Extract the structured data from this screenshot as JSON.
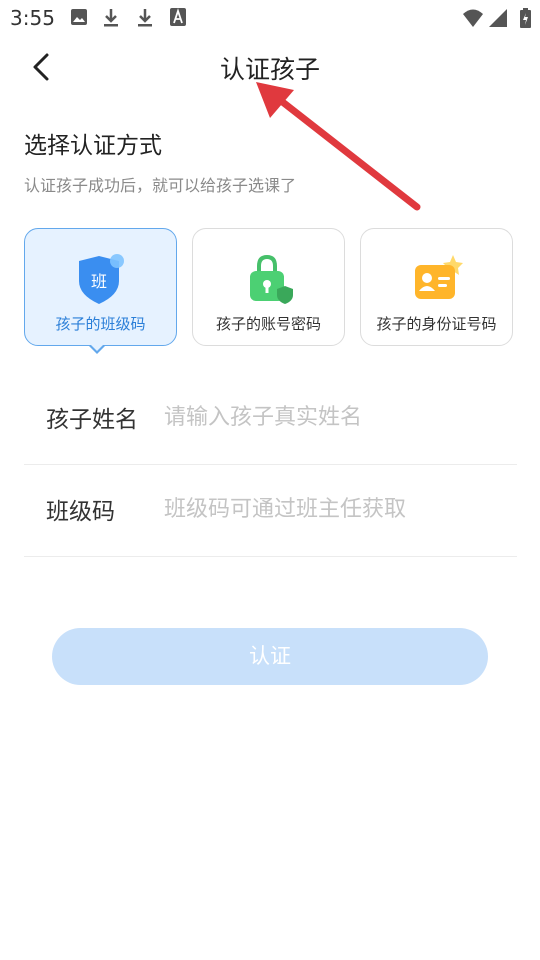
{
  "status_bar": {
    "time": "3:55",
    "icons": [
      "image-icon",
      "download-icon",
      "download-icon",
      "a-letter-icon",
      "wifi-icon",
      "signal-icon",
      "battery-icon"
    ]
  },
  "nav": {
    "back_icon": "back-chevron-icon",
    "title": "认证孩子"
  },
  "annotation": {
    "arrow_color": "#e0393e"
  },
  "section": {
    "title": "选择认证方式",
    "subtitle": "认证孩子成功后，就可以给孩子选课了"
  },
  "methods": [
    {
      "label": "孩子的班级码",
      "icon": "class-shield-icon",
      "icon_text": "班",
      "selected": true
    },
    {
      "label": "孩子的账号密码",
      "icon": "lock-icon",
      "selected": false
    },
    {
      "label": "孩子的身份证号码",
      "icon": "id-card-icon",
      "selected": false
    }
  ],
  "form": {
    "name_label": "孩子姓名",
    "name_placeholder": "请输入孩子真实姓名",
    "code_label": "班级码",
    "code_placeholder": "班级码可通过班主任获取"
  },
  "submit": {
    "label": "认证",
    "color": "#c8e0fa"
  },
  "colors": {
    "accent": "#2b7fd8",
    "selected_bg": "#e6f2ff",
    "selected_border": "#63a8ec"
  }
}
